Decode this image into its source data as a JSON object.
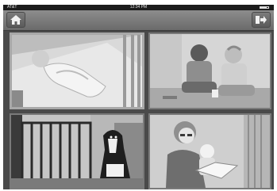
{
  "status_bar": {
    "carrier": "AT&T",
    "time": "12:34 PM"
  },
  "toolbar": {
    "home_icon": "home-icon",
    "exit_icon": "exit-icon"
  },
  "camera_tiles": [
    {
      "id": "cam-1",
      "scene": "sleeping-baby",
      "selected": true
    },
    {
      "id": "cam-2",
      "scene": "two-toddlers"
    },
    {
      "id": "cam-3",
      "scene": "dog-and-gate"
    },
    {
      "id": "cam-4",
      "scene": "mother-reading-with-baby"
    }
  ],
  "colors": {
    "background": "#4a4a4a",
    "toolbar": "#7a7a7a",
    "selected_border": "#a8a8a8"
  }
}
